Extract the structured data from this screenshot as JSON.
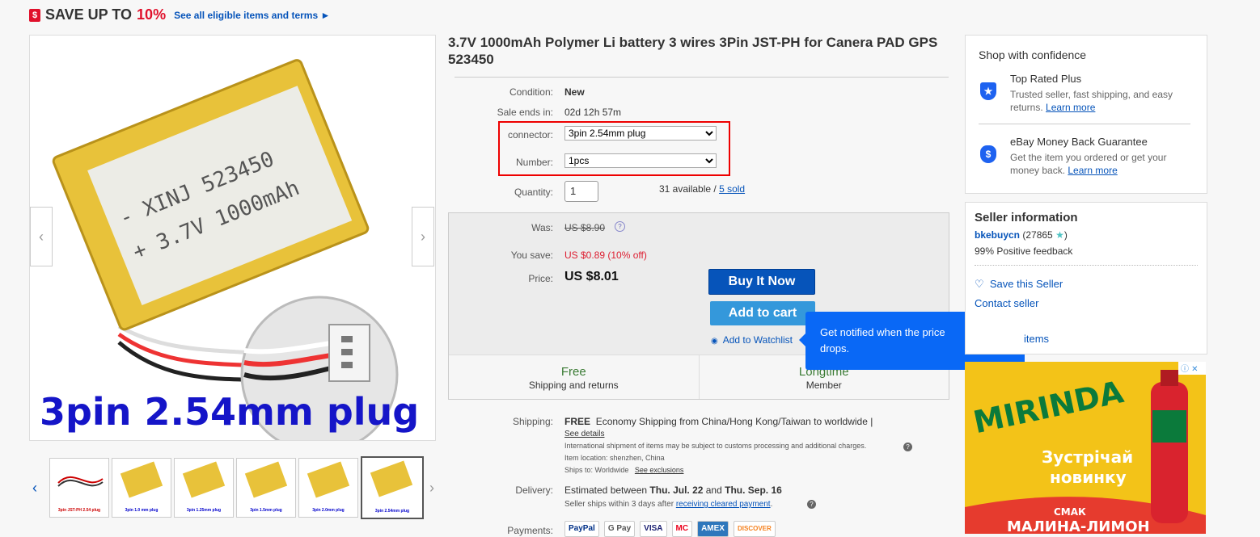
{
  "promo": {
    "prefix": "SAVE UP TO",
    "percent": "10%",
    "link": "See all eligible items and terms ►"
  },
  "product": {
    "title": "3.7V 1000mAh Polymer Li battery 3 wires 3Pin JST-PH for Canera PAD GPS 523450",
    "image_text_line1": "- XINJ 523450",
    "image_text_line2": "+ 3.7V 1000mAh",
    "image_caption": "3pin 2.54mm plug",
    "thumbnails": [
      {
        "caption": "3pin JST-PH 2.54 plug"
      },
      {
        "caption": "3pin 1.0 mm plug"
      },
      {
        "caption": "3pin 1.25mm plug"
      },
      {
        "caption": "3pin 1.5mm plug"
      },
      {
        "caption": "3pin 2.0mm plug"
      },
      {
        "caption": "3pin 2.54mm plug"
      }
    ]
  },
  "details": {
    "condition_label": "Condition:",
    "condition": "New",
    "sale_label": "Sale ends in:",
    "sale_value": "02d 12h 57m",
    "connector_label": "connector:",
    "connector_value": "3pin 2.54mm plug",
    "number_label": "Number:",
    "number_value": "1pcs",
    "quantity_label": "Quantity:",
    "quantity_value": "1",
    "available": "31 available / ",
    "sold": "5 sold"
  },
  "pricing": {
    "was_label": "Was:",
    "was": "US $8.90",
    "save_label": "You save:",
    "save": "US $0.89 (10% off)",
    "price_label": "Price:",
    "price": "US $8.01",
    "buy_now": "Buy It Now",
    "add_to_cart": "Add to cart",
    "watchlist": "Add to Watchlist",
    "free_title": "Free",
    "free_sub": "Shipping and returns",
    "longtime_title": "Longtime",
    "longtime_sub": "Member"
  },
  "tooltip": {
    "message": "Get notified when the price drops.",
    "close": "✕"
  },
  "shipping": {
    "label": "Shipping:",
    "free": "FREE",
    "desc": "Economy Shipping from China/Hong Kong/Taiwan to worldwide |",
    "see_details": "See details",
    "intl_note": "International shipment of items may be subject to customs processing and additional charges.",
    "location": "Item location:  shenzhen, China",
    "ships_to": "Ships to:  Worldwide",
    "see_exclusions": "See exclusions"
  },
  "delivery": {
    "label": "Delivery:",
    "text_prefix": "Estimated between ",
    "date1": "Thu. Jul. 22",
    "and": " and ",
    "date2": "Thu. Sep. 16",
    "note_prefix": "Seller ships within 3 days after ",
    "note_link": "receiving cleared payment",
    "note_suffix": "."
  },
  "payments": {
    "label": "Payments:",
    "methods": [
      "PayPal",
      "G Pay",
      "VISA",
      "MC",
      "AMEX",
      "DISCOVER"
    ]
  },
  "confidence": {
    "title": "Shop with confidence",
    "trp_title": "Top Rated Plus",
    "trp_desc": "Trusted seller, fast shipping, and easy returns. ",
    "trp_link": "Learn more",
    "mbg_title": "eBay Money Back Guarantee",
    "mbg_desc": "Get the item you ordered or get your money back. ",
    "mbg_link": "Learn more"
  },
  "seller": {
    "title": "Seller information",
    "name": "bkebuycn",
    "score": "(27865 ",
    "score_end": ")",
    "feedback": "99% Positive feedback",
    "save": "Save this Seller",
    "contact": "Contact seller",
    "items_partial": "items"
  },
  "ad": {
    "brand": "MIRINDA",
    "line1": "Зустрічай",
    "line2": "новинку",
    "line3": "СМАК",
    "line4": "МАЛИНА-ЛИМОН",
    "badge": "ⓘ ✕"
  },
  "colors": {
    "accent": "#0654ba",
    "sale_red": "#e0102b",
    "tooltip_blue": "#0968f6"
  }
}
